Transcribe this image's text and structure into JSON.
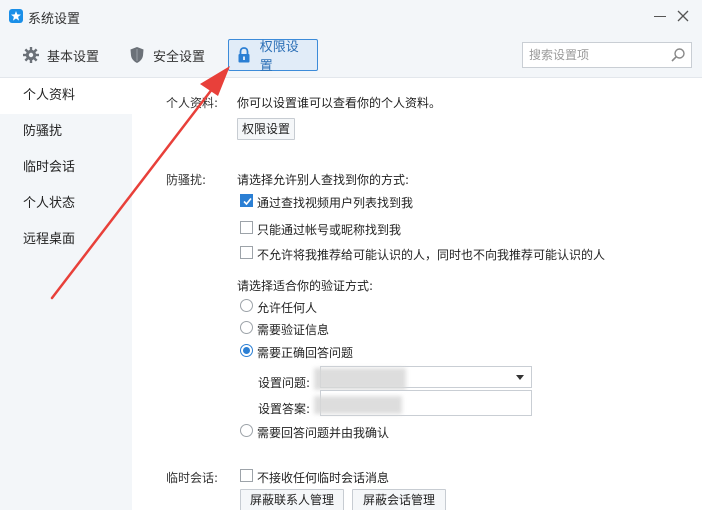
{
  "window": {
    "title": "系统设置"
  },
  "toolbar": {
    "basic": "基本设置",
    "security": "安全设置",
    "permissions": "权限设置",
    "search_placeholder": "搜索设置项"
  },
  "sidebar": {
    "items": [
      {
        "label": "个人资料"
      },
      {
        "label": "防骚扰"
      },
      {
        "label": "临时会话"
      },
      {
        "label": "个人状态"
      },
      {
        "label": "远程桌面"
      }
    ]
  },
  "profile": {
    "label": "个人资料:",
    "desc": "你可以设置谁可以查看你的个人资料。",
    "button": "权限设置"
  },
  "antiharass": {
    "label": "防骚扰:",
    "find_prompt": "请选择允许别人查找到你的方式:",
    "find_options": [
      {
        "label": "通过查找视频用户列表找到我",
        "checked": true
      },
      {
        "label": "只能通过帐号或昵称找到我",
        "checked": false
      },
      {
        "label": "不允许将我推荐给可能认识的人，同时也不向我推荐可能认识的人",
        "checked": false
      }
    ],
    "verify_prompt": "请选择适合你的验证方式:",
    "verify_options": [
      {
        "label": "允许任何人",
        "selected": false
      },
      {
        "label": "需要验证信息",
        "selected": false
      },
      {
        "label": "需要正确回答问题",
        "selected": true
      },
      {
        "label": "需要回答问题并由我确认",
        "selected": false
      }
    ],
    "question_label": "设置问题:",
    "answer_label": "设置答案:"
  },
  "tempchat": {
    "label": "临时会话:",
    "option": "不接收任何临时会话消息",
    "option_checked": false,
    "btn_contacts": "屏蔽联系人管理",
    "btn_sessions": "屏蔽会话管理"
  },
  "colors": {
    "accent": "#2b7fd4",
    "arrow": "#e8403a"
  }
}
